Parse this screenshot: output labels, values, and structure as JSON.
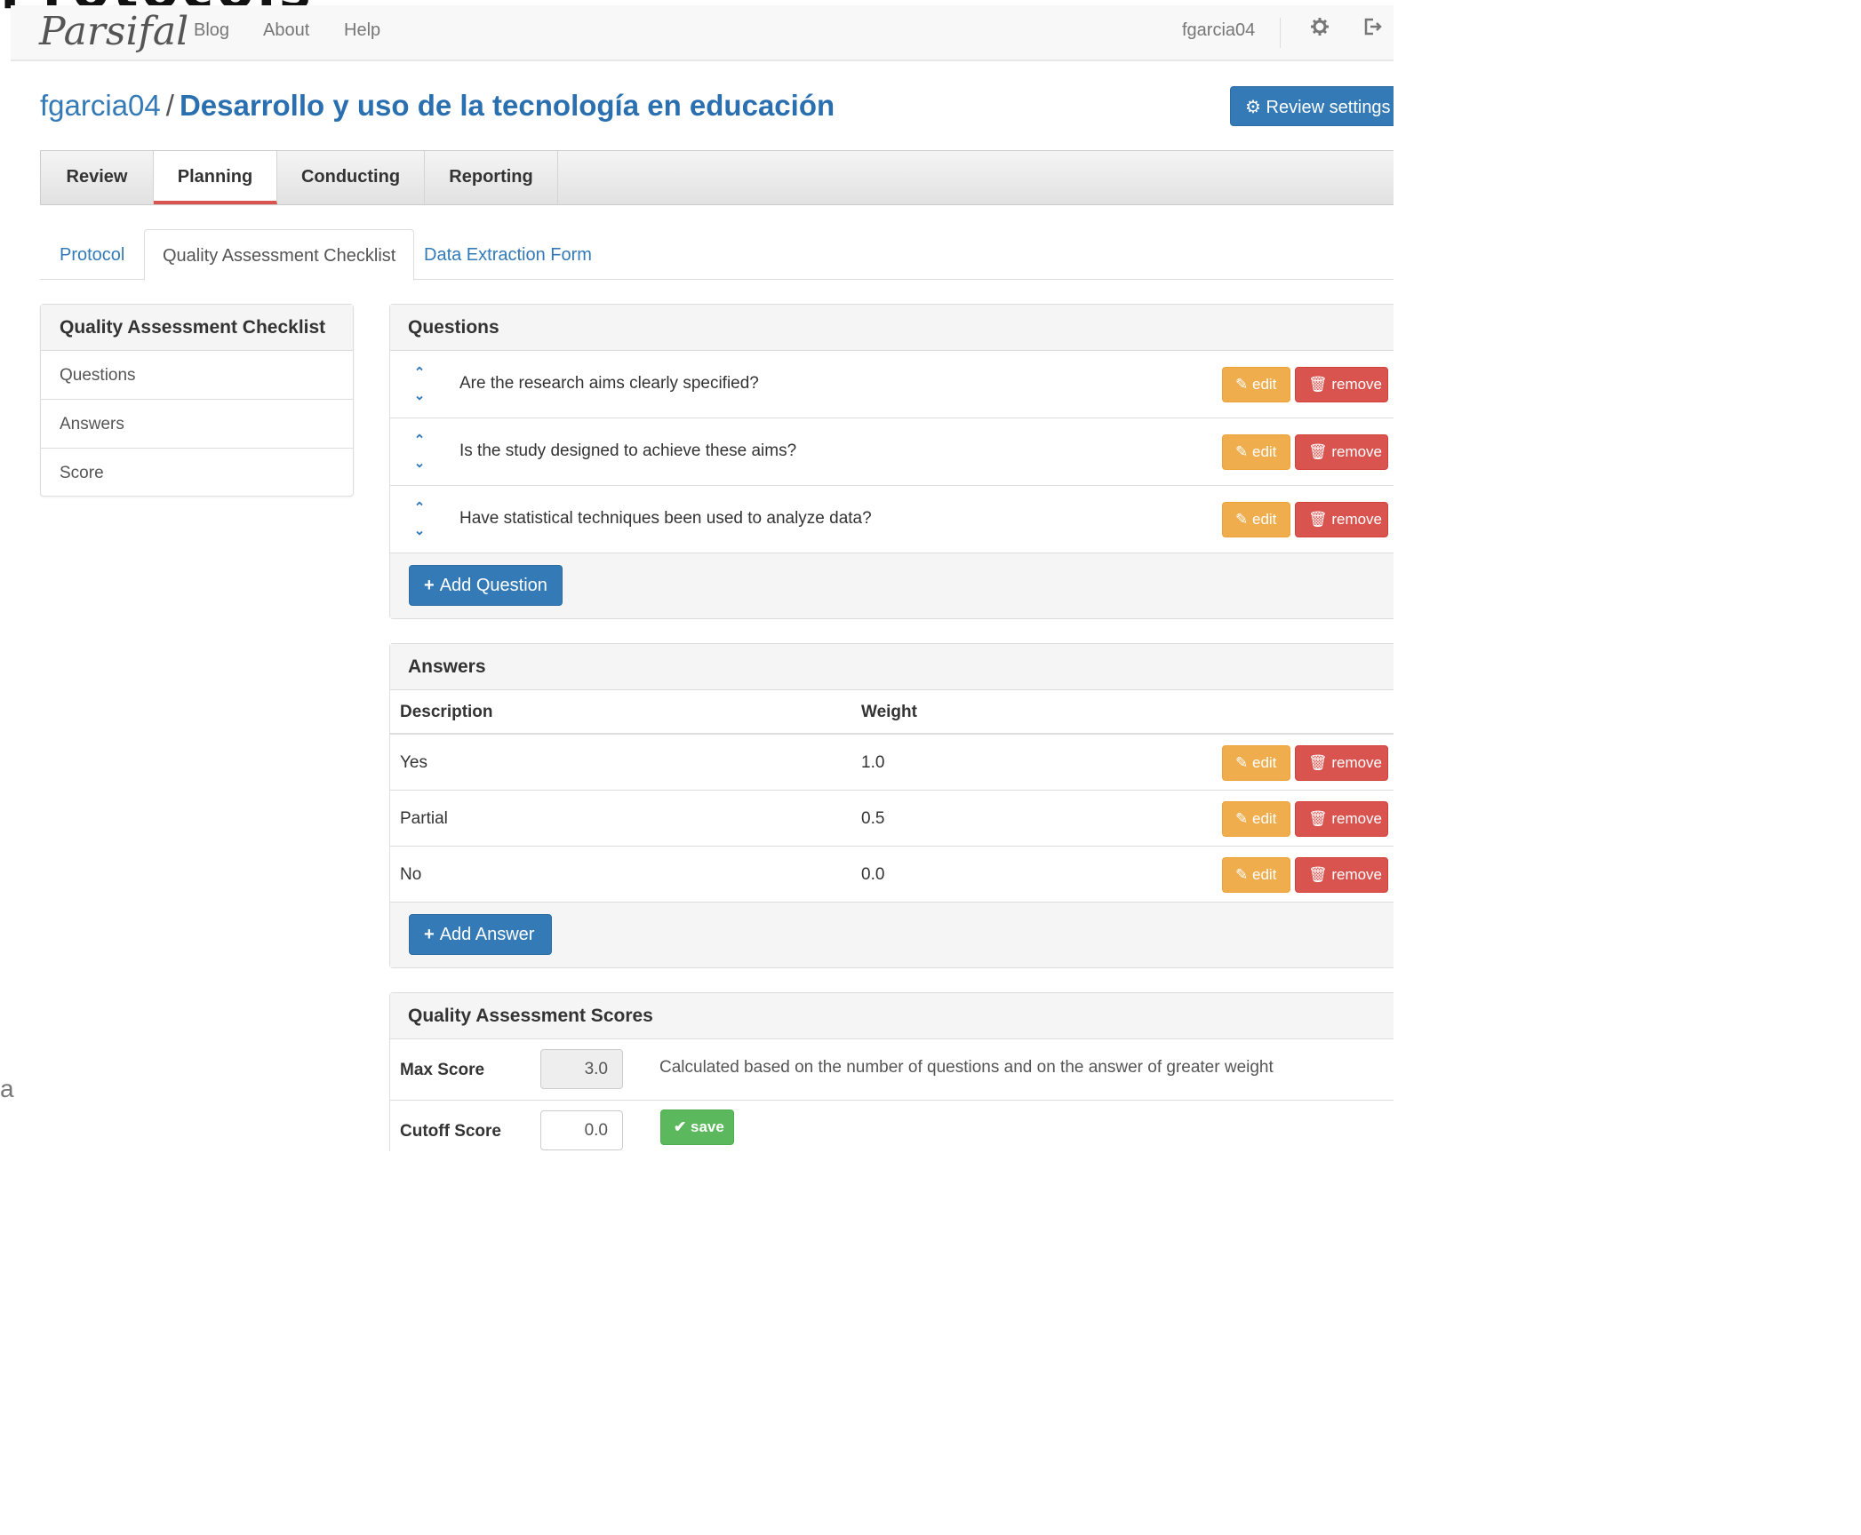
{
  "cropped_heading": "Protocols",
  "stray_char": "a",
  "navbar": {
    "brand": "Parsifal",
    "links": [
      "Blog",
      "About",
      "Help"
    ],
    "user": "fgarcia04",
    "settings_icon": "gear-icon",
    "logout_icon": "logout-icon"
  },
  "title": {
    "owner": "fgarcia04",
    "separator": "/",
    "review_name": "Desarrollo y uso de la tecnología en educación"
  },
  "review_settings_label": "Review settings",
  "main_tabs": [
    "Review",
    "Planning",
    "Conducting",
    "Reporting"
  ],
  "main_tab_active": "Planning",
  "sub_tabs": [
    "Protocol",
    "Quality Assessment Checklist",
    "Data Extraction Form"
  ],
  "sub_tab_active": "Quality Assessment Checklist",
  "sidebar": {
    "title": "Quality Assessment Checklist",
    "items": [
      "Questions",
      "Answers",
      "Score"
    ]
  },
  "questions_panel": {
    "title": "Questions",
    "questions": [
      "Are the research aims clearly specified?",
      "Is the study designed to achieve these aims?",
      "Have statistical techniques been used to analyze data?"
    ],
    "add_label": "Add Question"
  },
  "answers_panel": {
    "title": "Answers",
    "columns": [
      "Description",
      "Weight"
    ],
    "rows": [
      {
        "description": "Yes",
        "weight": "1.0"
      },
      {
        "description": "Partial",
        "weight": "0.5"
      },
      {
        "description": "No",
        "weight": "0.0"
      }
    ],
    "add_label": "Add Answer"
  },
  "buttons": {
    "edit": "edit",
    "remove": "remove",
    "save": "save"
  },
  "scores_panel": {
    "title": "Quality Assessment Scores",
    "max_score_label": "Max Score",
    "max_score_value": "3.0",
    "max_score_help": "Calculated based on the number of questions and on the answer of greater weight",
    "cutoff_label": "Cutoff Score",
    "cutoff_value": "0.0"
  },
  "colors": {
    "primary": "#337ab7",
    "warning": "#f0ad4e",
    "danger": "#d9534f",
    "success": "#5cb85c"
  }
}
